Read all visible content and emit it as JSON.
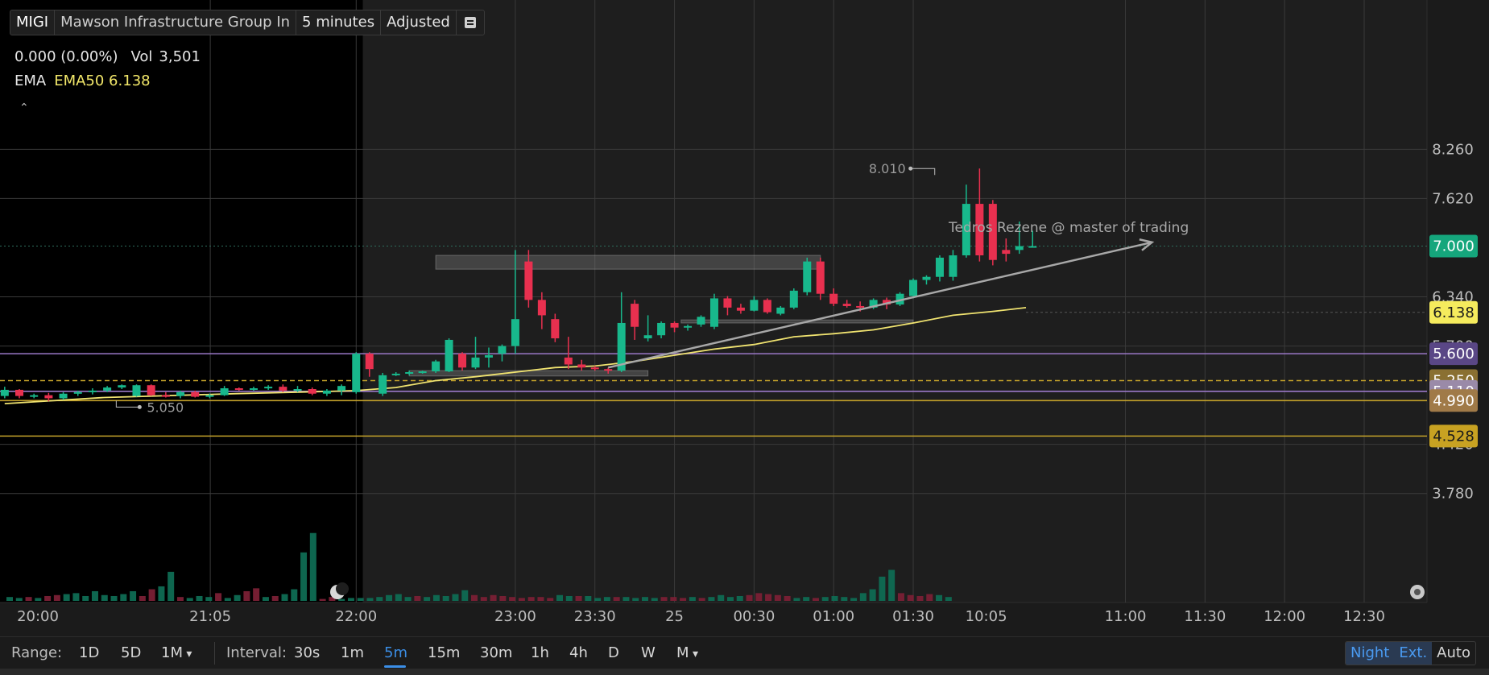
{
  "header": {
    "symbol": "MIGI",
    "description": "Mawson Infrastructure Group In",
    "interval": "5 minutes",
    "adjust": "Adjusted"
  },
  "quote": {
    "change": "0.000 (0.00%)",
    "volume_label": "Vol",
    "volume": "3,501"
  },
  "ema_legend": {
    "name": "EMA",
    "value": "EMA50 6.138"
  },
  "chart_data": {
    "type": "candlestick",
    "ylim": [
      3.5,
      8.3
    ],
    "price_ticks": [
      "8.260",
      "7.620",
      "6.340",
      "5.700",
      "4.420",
      "3.780"
    ],
    "time_ticks": [
      {
        "label": "20:00",
        "x": 0
      },
      {
        "label": "21:05",
        "x": 13
      },
      {
        "label": "22:00",
        "x": 24
      },
      {
        "label": "23:00",
        "x": 36
      },
      {
        "label": "23:30",
        "x": 42
      },
      {
        "label": "25",
        "x": 48
      },
      {
        "label": "00:30",
        "x": 54
      },
      {
        "label": "01:00",
        "x": 60
      },
      {
        "label": "01:30",
        "x": 66
      },
      {
        "label": "10:05",
        "x": 71.5
      },
      {
        "label": "11:00",
        "x": 82
      },
      {
        "label": "11:30",
        "x": 88
      },
      {
        "label": "12:00",
        "x": 94
      },
      {
        "label": "12:30",
        "x": 100
      }
    ],
    "x_domain": [
      -2.5,
      106
    ],
    "extended_hours_end": 24.5,
    "candles": [
      [
        5.05,
        5.17,
        5.02,
        5.13
      ],
      [
        5.13,
        5.14,
        5.02,
        5.05
      ],
      [
        5.05,
        5.08,
        5.02,
        5.06
      ],
      [
        5.06,
        5.09,
        4.98,
        5.02
      ],
      [
        5.02,
        5.1,
        5.0,
        5.08
      ],
      [
        5.08,
        5.12,
        5.05,
        5.1
      ],
      [
        5.1,
        5.15,
        5.07,
        5.12
      ],
      [
        5.12,
        5.18,
        5.1,
        5.16
      ],
      [
        5.16,
        5.2,
        5.14,
        5.19
      ],
      [
        5.05,
        5.2,
        5.04,
        5.19
      ],
      [
        5.19,
        5.2,
        5.05,
        5.06
      ],
      [
        5.06,
        5.1,
        5.03,
        5.05
      ],
      [
        5.05,
        5.12,
        5.02,
        5.1
      ],
      [
        5.1,
        5.12,
        5.03,
        5.04
      ],
      [
        5.04,
        5.08,
        5.02,
        5.06
      ],
      [
        5.06,
        5.18,
        5.05,
        5.15
      ],
      [
        5.15,
        5.16,
        5.12,
        5.14
      ],
      [
        5.14,
        5.17,
        5.12,
        5.15
      ],
      [
        5.15,
        5.19,
        5.13,
        5.17
      ],
      [
        5.17,
        5.2,
        5.1,
        5.12
      ],
      [
        5.12,
        5.18,
        5.1,
        5.14
      ],
      [
        5.14,
        5.16,
        5.06,
        5.08
      ],
      [
        5.08,
        5.14,
        5.05,
        5.12
      ],
      [
        5.12,
        5.2,
        5.06,
        5.18
      ],
      [
        5.1,
        5.62,
        5.08,
        5.6
      ],
      [
        5.6,
        5.62,
        5.3,
        5.4
      ],
      [
        5.08,
        5.35,
        5.05,
        5.32
      ],
      [
        5.33,
        5.36,
        5.31,
        5.34
      ],
      [
        5.34,
        5.38,
        5.32,
        5.36
      ],
      [
        5.36,
        5.38,
        5.34,
        5.37
      ],
      [
        5.37,
        5.52,
        5.35,
        5.5
      ],
      [
        5.37,
        5.8,
        5.36,
        5.78
      ],
      [
        5.6,
        5.62,
        5.38,
        5.42
      ],
      [
        5.42,
        5.82,
        5.4,
        5.55
      ],
      [
        5.55,
        5.68,
        5.42,
        5.58
      ],
      [
        5.6,
        5.72,
        5.5,
        5.7
      ],
      [
        5.7,
        6.95,
        5.6,
        6.05
      ],
      [
        6.8,
        6.95,
        6.2,
        6.3
      ],
      [
        6.3,
        6.4,
        5.92,
        6.1
      ],
      [
        6.05,
        6.12,
        5.75,
        5.8
      ],
      [
        5.55,
        5.82,
        5.4,
        5.46
      ],
      [
        5.46,
        5.52,
        5.38,
        5.42
      ],
      [
        5.42,
        5.44,
        5.38,
        5.4
      ],
      [
        5.4,
        5.42,
        5.34,
        5.38
      ],
      [
        5.38,
        6.4,
        5.36,
        6.0
      ],
      [
        6.25,
        6.3,
        5.78,
        5.95
      ],
      [
        5.8,
        6.1,
        5.76,
        5.84
      ],
      [
        5.84,
        6.02,
        5.8,
        6.0
      ],
      [
        6.0,
        6.02,
        5.88,
        5.94
      ],
      [
        5.94,
        5.98,
        5.9,
        5.96
      ],
      [
        5.98,
        6.1,
        5.95,
        6.08
      ],
      [
        5.95,
        6.38,
        5.92,
        6.32
      ],
      [
        6.32,
        6.35,
        6.1,
        6.2
      ],
      [
        6.2,
        6.25,
        6.12,
        6.16
      ],
      [
        6.16,
        6.35,
        6.15,
        6.3
      ],
      [
        6.3,
        6.32,
        6.12,
        6.14
      ],
      [
        6.12,
        6.22,
        6.1,
        6.2
      ],
      [
        6.2,
        6.45,
        6.18,
        6.42
      ],
      [
        6.4,
        6.85,
        6.36,
        6.8
      ],
      [
        6.8,
        6.85,
        6.3,
        6.38
      ],
      [
        6.38,
        6.45,
        6.22,
        6.25
      ],
      [
        6.25,
        6.3,
        6.2,
        6.22
      ],
      [
        6.22,
        6.28,
        6.15,
        6.2
      ],
      [
        6.2,
        6.32,
        6.18,
        6.3
      ],
      [
        6.3,
        6.33,
        6.18,
        6.24
      ],
      [
        6.24,
        6.4,
        6.22,
        6.38
      ],
      [
        6.35,
        6.58,
        6.32,
        6.56
      ],
      [
        6.56,
        6.62,
        6.5,
        6.6
      ],
      [
        6.6,
        6.88,
        6.54,
        6.85
      ],
      [
        6.6,
        6.95,
        6.55,
        6.88
      ],
      [
        6.88,
        7.8,
        6.85,
        7.55
      ],
      [
        7.55,
        8.01,
        6.8,
        6.88
      ],
      [
        7.55,
        7.6,
        6.75,
        6.82
      ],
      [
        6.95,
        7.1,
        6.8,
        6.9
      ],
      [
        6.95,
        7.32,
        6.9,
        7.0
      ],
      [
        6.98,
        7.2,
        6.98,
        7.0
      ]
    ],
    "volumes": [
      0.04,
      0.03,
      0.04,
      0.03,
      0.05,
      0.06,
      0.07,
      0.08,
      0.05,
      0.1,
      0.06,
      0.05,
      0.07,
      0.1,
      0.05,
      0.12,
      0.15,
      0.3,
      0.04,
      0.03,
      0.05,
      0.04,
      0.08,
      0.03,
      0.06,
      0.1,
      0.13,
      0.04,
      0.05,
      0.07,
      0.12,
      0.5,
      0.7,
      0.02,
      0.04,
      0.02,
      0.03,
      0.03,
      0.03,
      0.04,
      0.06,
      0.07,
      0.04,
      0.05,
      0.04,
      0.06,
      0.05,
      0.07,
      0.11,
      0.06,
      0.04,
      0.06,
      0.05,
      0.04,
      0.03,
      0.04,
      0.04,
      0.03,
      0.06,
      0.05,
      0.05,
      0.05,
      0.03,
      0.04,
      0.04,
      0.04,
      0.03,
      0.04,
      0.03,
      0.04,
      0.04,
      0.03,
      0.04,
      0.03,
      0.04,
      0.06,
      0.04,
      0.05,
      0.06,
      0.08,
      0.07,
      0.06,
      0.05,
      0.03,
      0.04,
      0.03,
      0.04,
      0.05,
      0.04,
      0.03,
      0.08,
      0.12,
      0.25,
      0.32,
      0.08,
      0.06,
      0.05,
      0.07,
      0.06,
      0.04
    ],
    "volume_max": 0.98,
    "ema50": [
      [
        -2.5,
        4.95
      ],
      [
        5,
        5.03
      ],
      [
        15,
        5.08
      ],
      [
        22,
        5.11
      ],
      [
        24,
        5.12
      ],
      [
        27,
        5.16
      ],
      [
        30,
        5.25
      ],
      [
        33,
        5.3
      ],
      [
        36,
        5.36
      ],
      [
        39,
        5.42
      ],
      [
        42,
        5.44
      ],
      [
        45,
        5.5
      ],
      [
        48,
        5.58
      ],
      [
        51,
        5.66
      ],
      [
        54,
        5.72
      ],
      [
        57,
        5.82
      ],
      [
        60,
        5.86
      ],
      [
        63,
        5.91
      ],
      [
        66,
        6.0
      ],
      [
        69,
        6.1
      ],
      [
        72,
        6.15
      ],
      [
        74.5,
        6.2
      ]
    ],
    "rectangles": [
      {
        "x1": 30,
        "x2": 59,
        "y1": 6.88,
        "y2": 6.7
      },
      {
        "x1": 28,
        "x2": 46,
        "y1": 5.38,
        "y2": 5.31
      },
      {
        "x1": 48.5,
        "x2": 66,
        "y1": 6.04,
        "y2": 6.0
      }
    ],
    "trendline": {
      "x1": 43,
      "y1": 5.42,
      "x2": 84,
      "y2": 7.05
    },
    "annotation": "Tedros Rezene @ master of trading",
    "hlines": [
      {
        "price": 5.6,
        "label": "5.600",
        "color": "#9a78c8",
        "bg": "#5a4786",
        "fg": "#ffffff",
        "style": "solid"
      },
      {
        "price": 5.25,
        "label": "5.250",
        "color": "#c2a02a",
        "bg": "#8a7032",
        "fg": "#ffffff",
        "style": "dashed"
      },
      {
        "price": 5.11,
        "label": "5.110",
        "color": "#9a78c8",
        "bg": "#9a8aa8",
        "fg": "#ffffff",
        "style": "solid"
      },
      {
        "price": 4.99,
        "label": "4.990",
        "color": "#c2a02a",
        "bg": "#a07a48",
        "fg": "#ffffff",
        "style": "solid"
      },
      {
        "price": 4.528,
        "label": "4.528",
        "color": "#c2a02a",
        "bg": "#c8a222",
        "fg": "#1a1a1a",
        "style": "solid"
      }
    ],
    "last_price": {
      "price": 7.0,
      "label": "7.000"
    },
    "ema_price": {
      "price": 6.138,
      "label": "6.138"
    },
    "high_marker": {
      "x": 67.5,
      "price": 8.01,
      "label": "8.010"
    },
    "low_marker": {
      "x": 5,
      "price": 5.0,
      "label": "5.050"
    },
    "colors": {
      "up": "#18b88c",
      "down": "#e8304f",
      "ema": "#f0e370",
      "grid": "#3a3a3a",
      "premarket_bg": "#000000",
      "session_bg": "#1e1e1e",
      "last_price_bg": "#15a67c",
      "ema_label_bg": "#f5eb5d"
    }
  },
  "bottom_bar": {
    "range_label": "Range:",
    "ranges": [
      "1D",
      "5D",
      "1M"
    ],
    "interval_label": "Interval:",
    "intervals": [
      "30s",
      "1m",
      "5m",
      "15m",
      "30m",
      "1h",
      "4h",
      "D",
      "W",
      "M"
    ],
    "active_interval": "5m",
    "night": "Night",
    "ext": "Ext.",
    "auto": "Auto"
  }
}
